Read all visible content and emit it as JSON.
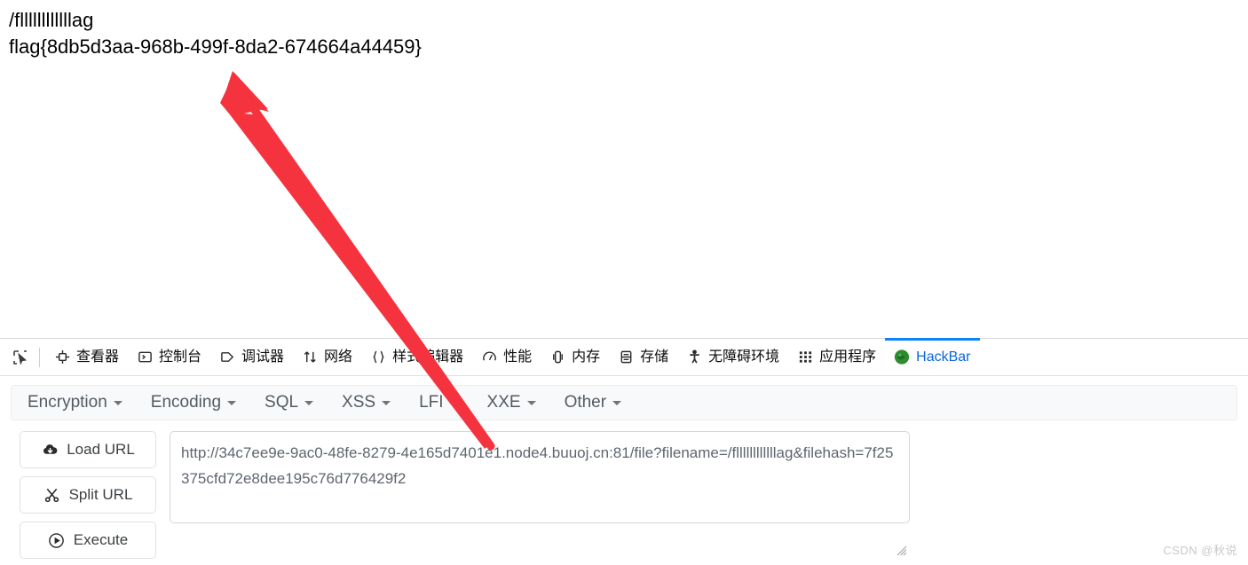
{
  "page": {
    "line1": "/fllllllllllllag",
    "line2": "flag{8db5d3aa-968b-499f-8da2-674664a44459}"
  },
  "devtools": {
    "picker_icon": "element-picker-icon",
    "tabs": [
      {
        "label": "查看器",
        "icon": "inspector-icon",
        "active": false
      },
      {
        "label": "控制台",
        "icon": "console-icon",
        "active": false
      },
      {
        "label": "调试器",
        "icon": "debugger-icon",
        "active": false
      },
      {
        "label": "网络",
        "icon": "network-icon",
        "active": false
      },
      {
        "label": "样式编辑器",
        "icon": "style-editor-icon",
        "active": false
      },
      {
        "label": "性能",
        "icon": "performance-icon",
        "active": false
      },
      {
        "label": "内存",
        "icon": "memory-icon",
        "active": false
      },
      {
        "label": "存储",
        "icon": "storage-icon",
        "active": false
      },
      {
        "label": "无障碍环境",
        "icon": "accessibility-icon",
        "active": false
      },
      {
        "label": "应用程序",
        "icon": "application-icon",
        "active": false
      },
      {
        "label": "HackBar",
        "icon": "hackbar-icon",
        "active": true
      }
    ],
    "active_tab_color": "#0a84ff"
  },
  "hackbar": {
    "menus": [
      {
        "label": "Encryption"
      },
      {
        "label": "Encoding"
      },
      {
        "label": "SQL"
      },
      {
        "label": "XSS"
      },
      {
        "label": "LFI"
      },
      {
        "label": "XXE"
      },
      {
        "label": "Other"
      }
    ],
    "buttons": [
      {
        "label": "Load URL",
        "icon": "cloud-download-icon"
      },
      {
        "label": "Split URL",
        "icon": "scissors-icon"
      },
      {
        "label": "Execute",
        "icon": "play-circle-icon"
      }
    ],
    "url_value": "http://34c7ee9e-9ac0-48fe-8279-4e165d7401e1.node4.buuoj.cn:81/file?filename=/fllllllllllllag&filehash=7f25375cfd72e8dee195c76d776429f2",
    "url_placeholder": "",
    "resize_grip_icon": "resize-grip-icon"
  },
  "annotation": {
    "arrow_color": "#f5333f",
    "arrow_icon": "red-arrow-icon"
  },
  "watermark": {
    "text": "CSDN @秋说"
  }
}
